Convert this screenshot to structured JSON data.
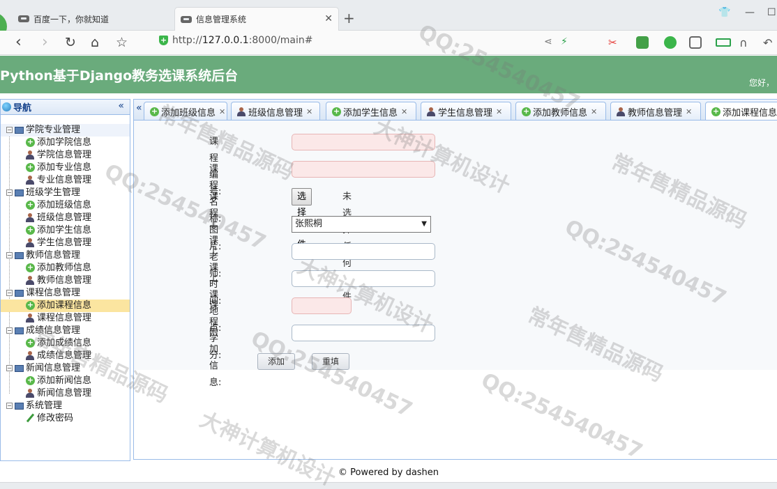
{
  "browser": {
    "tabs": [
      {
        "label": "百度一下，你就知道",
        "active": false
      },
      {
        "label": "信息管理系统",
        "active": true
      }
    ],
    "url_scheme": "http://",
    "url_host": "127.0.0.1",
    "url_rest": ":8000/main#"
  },
  "app": {
    "title": "Python基于Django教务选课系统后台",
    "greeting": "您好，"
  },
  "sidebar": {
    "title": "导航",
    "groups": [
      {
        "label": "学院专业管理",
        "items": [
          "添加学院信息",
          "学院信息管理",
          "添加专业信息",
          "专业信息管理"
        ]
      },
      {
        "label": "班级学生管理",
        "items": [
          "添加班级信息",
          "班级信息管理",
          "添加学生信息",
          "学生信息管理"
        ]
      },
      {
        "label": "教师信息管理",
        "items": [
          "添加教师信息",
          "教师信息管理"
        ]
      },
      {
        "label": "课程信息管理",
        "items": [
          "添加课程信息",
          "课程信息管理"
        ]
      },
      {
        "label": "成绩信息管理",
        "items": [
          "添加成绩信息",
          "成绩信息管理"
        ]
      },
      {
        "label": "新闻信息管理",
        "items": [
          "添加新闻信息",
          "新闻信息管理"
        ]
      },
      {
        "label": "系统管理",
        "items": [
          "修改密码"
        ]
      }
    ],
    "selected": "添加课程信息"
  },
  "main_tabs": [
    {
      "label": "添加班级信息",
      "icon": "plus-icon"
    },
    {
      "label": "班级信息管理",
      "icon": "person-icon"
    },
    {
      "label": "添加学生信息",
      "icon": "plus-icon"
    },
    {
      "label": "学生信息管理",
      "icon": "person-icon"
    },
    {
      "label": "添加教师信息",
      "icon": "plus-icon"
    },
    {
      "label": "教师信息管理",
      "icon": "person-icon"
    },
    {
      "label": "添加课程信息",
      "icon": "plus-icon"
    }
  ],
  "form": {
    "course_id_label": "课程编号:",
    "course_name_label": "课程名称:",
    "course_image_label": "课程图片:",
    "file_button": "选择文件",
    "file_status": "未选择任何文件",
    "teacher_label": "上课老师:",
    "teacher_value": "张熙桐",
    "time_label": "上课时间:",
    "place_label": "上课地点:",
    "credit_label": "课程学分:",
    "extra_label": "附加信息:",
    "add_button": "添加",
    "reset_button": "重填"
  },
  "footer": "© Powered by dashen",
  "watermark": {
    "qq": "QQ:254540457",
    "line1": "大神计算机设计",
    "line2": "常年售精品源码"
  },
  "colors": {
    "header_green": "#6aab7c",
    "panel_border": "#99bbe8",
    "selected_row": "#fbe5a0",
    "invalid_field": "#fbe8e8"
  }
}
